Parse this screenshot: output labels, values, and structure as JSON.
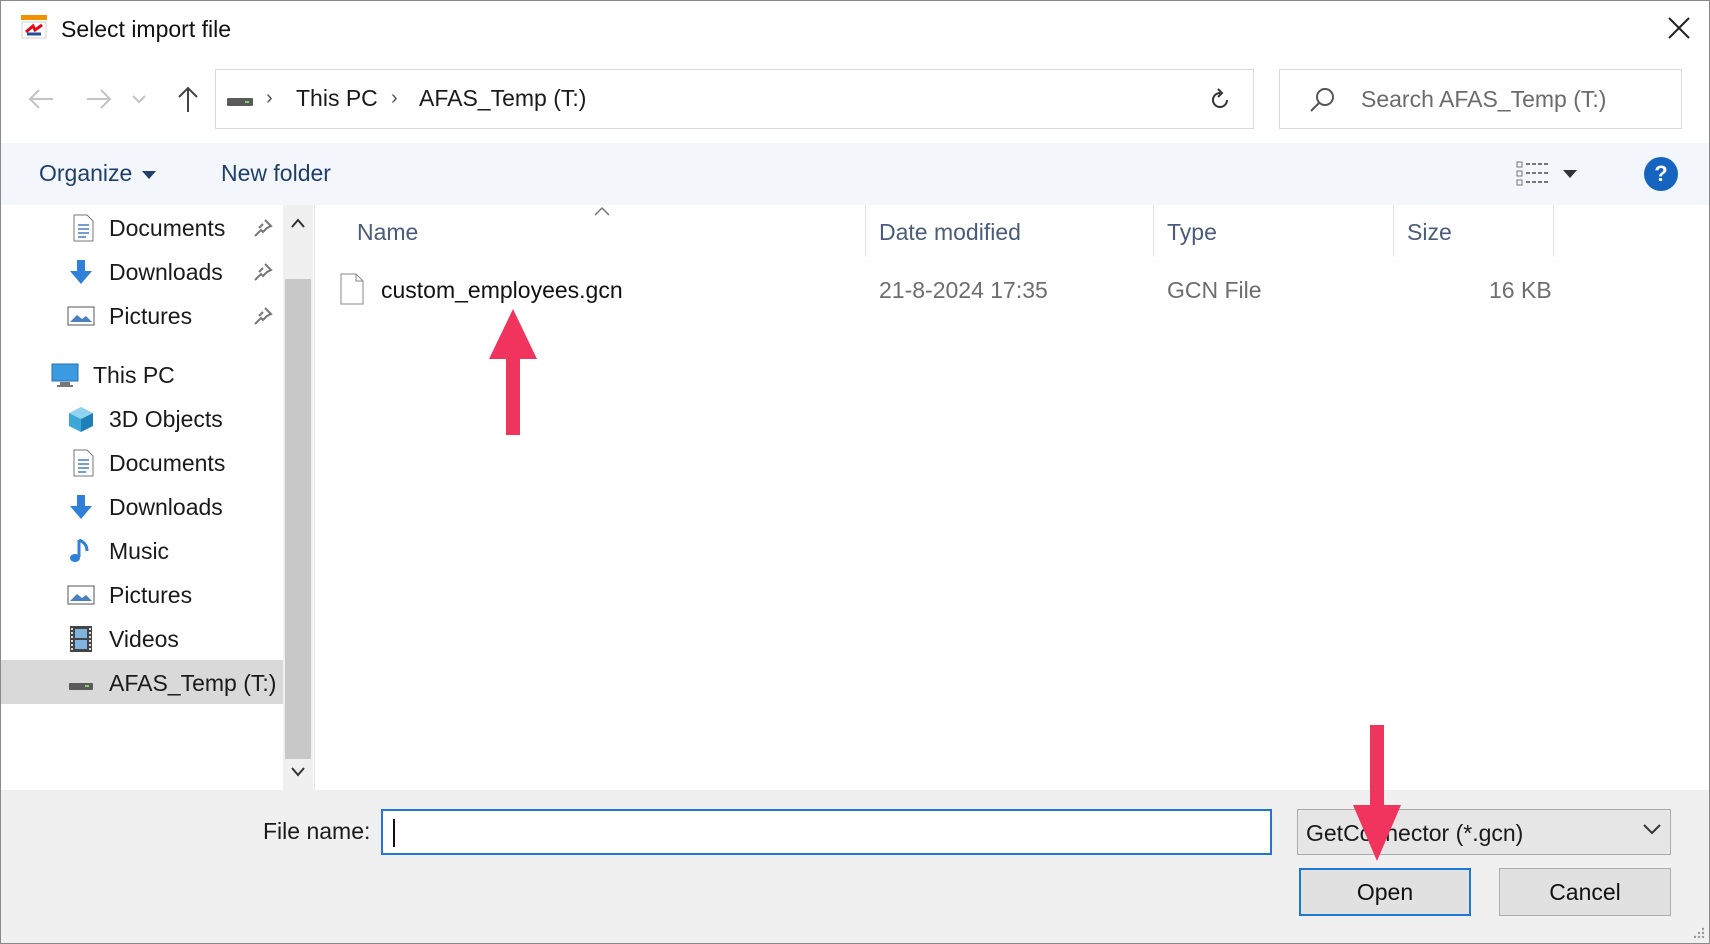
{
  "window": {
    "title": "Select import file",
    "close_label": "✕"
  },
  "address": {
    "crumbs": [
      "This PC",
      "AFAS_Temp (T:)"
    ],
    "search_placeholder": "Search AFAS_Temp (T:)"
  },
  "toolbar": {
    "organize_label": "Organize",
    "new_folder_label": "New folder",
    "help_label": "?"
  },
  "sidebar": {
    "items": [
      {
        "label": "Documents",
        "icon": "documents-icon",
        "pinned": true
      },
      {
        "label": "Downloads",
        "icon": "downloads-icon",
        "pinned": true
      },
      {
        "label": "Pictures",
        "icon": "pictures-icon",
        "pinned": true
      },
      {
        "label": "This PC",
        "icon": "this-pc-icon"
      },
      {
        "label": "3D Objects",
        "icon": "3d-objects-icon"
      },
      {
        "label": "Documents",
        "icon": "documents-icon"
      },
      {
        "label": "Downloads",
        "icon": "downloads-icon"
      },
      {
        "label": "Music",
        "icon": "music-icon"
      },
      {
        "label": "Pictures",
        "icon": "pictures-icon"
      },
      {
        "label": "Videos",
        "icon": "videos-icon"
      },
      {
        "label": "AFAS_Temp (T:)",
        "icon": "drive-icon",
        "selected": true
      }
    ]
  },
  "filelist": {
    "columns": [
      "Name",
      "Date modified",
      "Type",
      "Size"
    ],
    "rows": [
      {
        "name": "custom_employees.gcn",
        "date": "21-8-2024 17:35",
        "type": "GCN File",
        "size": "16 KB"
      }
    ]
  },
  "bottom": {
    "file_name_label": "File name:",
    "file_name_value": "",
    "file_type_value": "GetConnector (*.gcn)",
    "open_label": "Open",
    "cancel_label": "Cancel"
  },
  "colors": {
    "accent": "#1f78d1",
    "annotation_arrow": "#f0345e",
    "help": "#1565c0"
  }
}
